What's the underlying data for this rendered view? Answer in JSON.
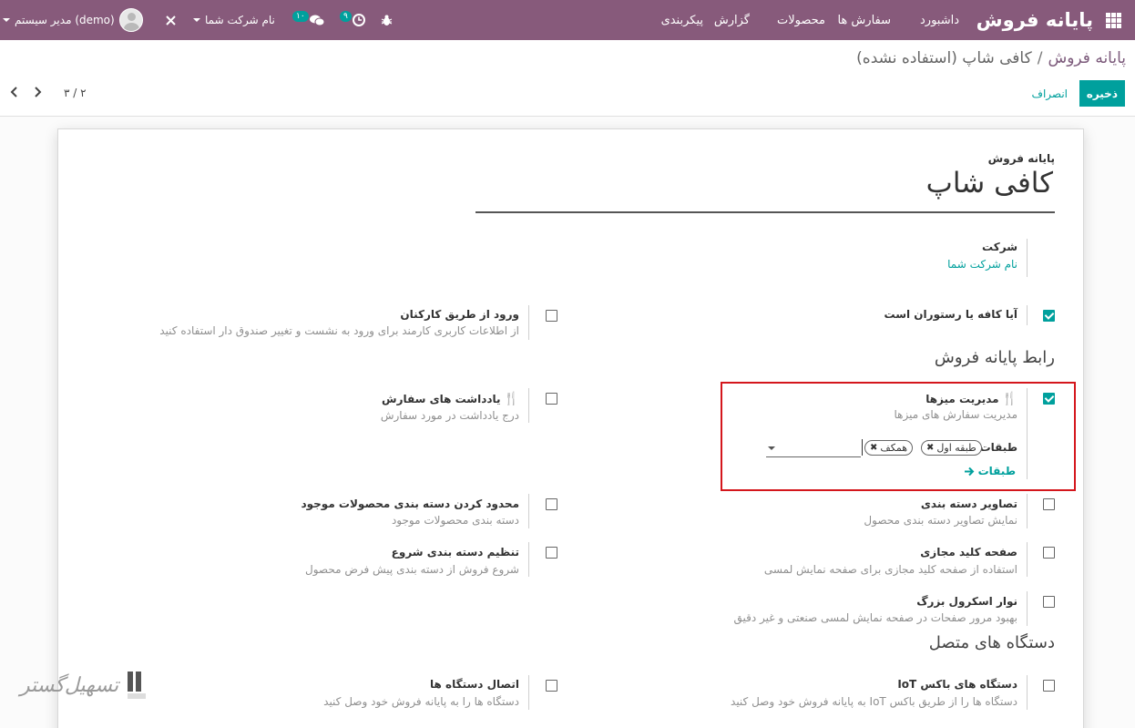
{
  "navbar": {
    "app_title": "پایانه فروش",
    "menu": [
      "داشبورد",
      "سفارش ها",
      "محصولات",
      "گزارش",
      "پیکربندی"
    ],
    "company": "نام شرکت شما",
    "user": "مدیر سیستم (demo)",
    "activity_badge": "۹",
    "messages_badge": "۱۰",
    "icons": [
      "apps-icon",
      "clock-icon",
      "chat-icon",
      "bug-icon",
      "tools-icon",
      "avatar"
    ]
  },
  "control_panel": {
    "breadcrumb_root": "پایانه فروش",
    "breadcrumb_sep": "/",
    "breadcrumb_current": "کافی شاپ (استفاده نشده)",
    "save_label": "ذخیره",
    "discard_label": "انصراف",
    "pager_value": "۳ / ۲"
  },
  "form": {
    "model_label": "پایانه فروش",
    "name": "کافی شاپ",
    "company_label": "شرکت",
    "company_value": "نام شرکت شما",
    "is_bar_label": "آیا کافه یا رستوران است",
    "is_bar_checked": true,
    "employee_login_title": "ورود از طریق کارکنان",
    "employee_login_desc": "از اطلاعات کاربری کارمند برای ورود به نشست و تغییر صندوق دار استفاده کنید",
    "employee_login_checked": false,
    "section_interface": "رابط پایانه فروش",
    "table_mgmt_title": "مدیریت میزها",
    "table_mgmt_desc": "مدیریت سفارش های میزها",
    "table_mgmt_checked": true,
    "floors_label": "طبقات",
    "floor_tags": [
      "طبقه اول",
      "همکف"
    ],
    "floors_link": "طبقات",
    "order_notes_title": "یادداشت های سفارش",
    "order_notes_desc": "درج یادداشت در مورد سفارش",
    "order_notes_checked": false,
    "category_images_title": "تصاویر دسته بندی",
    "category_images_desc": "نمایش تصاویر دسته بندی محصول",
    "category_images_checked": false,
    "restrict_categ_title": "محدود کردن دسته بندی محصولات موجود",
    "restrict_categ_desc": "دسته بندی محصولات موجود",
    "restrict_categ_checked": false,
    "virtual_kb_title": "صفحه کلید مجازی",
    "virtual_kb_desc": "استفاده از صفحه کلید مجازی برای صفحه نمایش لمسی",
    "virtual_kb_checked": false,
    "start_categ_title": "تنظیم دسته بندی شروع",
    "start_categ_desc": "شروع فروش از دسته بندی پیش فرض محصول",
    "start_categ_checked": false,
    "large_scroll_title": "نوار اسکرول بزرگ",
    "large_scroll_desc": "بهبود مرور صفحات در صفحه نمایش لمسی صنعتی و غیر دقیق",
    "large_scroll_checked": false,
    "section_devices": "دستگاه های متصل",
    "iot_title": "دستگاه های باکس IoT",
    "iot_desc": "دستگاه ها را از طریق باکس IoT به پایانه فروش خود وصل کنید",
    "iot_checked": false,
    "connect_devices_title": "اتصال دستگاه ها",
    "connect_devices_desc": "دستگاه ها را به پایانه فروش خود وصل کنید",
    "connect_devices_checked": false
  },
  "watermark_text": "تسهیل‌گستر",
  "colors": {
    "navbar": "#875a7b",
    "primary": "#00a09d",
    "highlight_border": "#d4161c"
  }
}
